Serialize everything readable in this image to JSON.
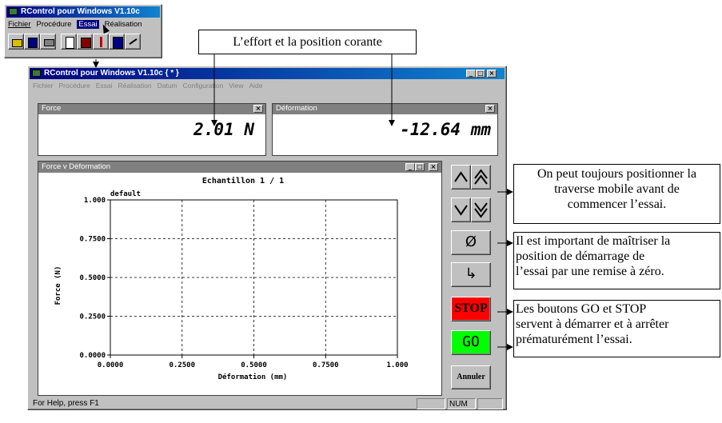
{
  "small_window": {
    "title": "RControl pour Windows V1.10c",
    "menu": [
      "Fichier",
      "Procédure",
      "Essai",
      "Réalisation"
    ],
    "highlighted_menu": "Essai",
    "toolbar_icons": [
      "open-icon",
      "save-icon",
      "print-icon",
      "report-icon",
      "zero-icon",
      "tool-icon",
      "clipboard-icon",
      "graph-icon"
    ]
  },
  "main_window": {
    "title": "RControl pour Windows V1.10c { * }",
    "menu": [
      "Fichier",
      "Procédure",
      "Essai",
      "Réalisation",
      "Datum",
      "Configuration",
      "View",
      "Aide"
    ],
    "status": {
      "help": "For Help, press F1",
      "num": "NUM"
    }
  },
  "force_panel": {
    "title": "Force",
    "value": "2.01 N"
  },
  "deformation_panel": {
    "title": "Déformation",
    "value": "-12.64 mm"
  },
  "graph_window": {
    "title": "Force v Déformation",
    "sample_label": "Echantillon 1 / 1",
    "default_label": "default"
  },
  "side_buttons": {
    "up": "^",
    "fast_up": "^^",
    "down": "v",
    "fast_down": "vv",
    "zero": "Ø",
    "return": "↳",
    "stop": "STOP",
    "go": "GO",
    "cancel": "Annuler",
    "colors": {
      "stop": "#ff0000",
      "go": "#00ff00"
    }
  },
  "callouts": {
    "top": "L’effort et la position corante",
    "move": [
      "On peut toujours positionner la",
      "traverse mobile avant de",
      "commencer l’essai."
    ],
    "zero": [
      "Il est important de maîtriser la",
      "position de démarrage de",
      "l’essai par une remise à zéro."
    ],
    "gostop": [
      "Les boutons GO et STOP",
      "servent à démarrer et à arrêter",
      "prématurément l’essai."
    ]
  },
  "chart_data": {
    "type": "line",
    "title": "Echantillon 1 / 1",
    "xlabel": "Déformation (mm)",
    "ylabel": "Force (N)",
    "xlim": [
      0,
      1
    ],
    "ylim": [
      0,
      1
    ],
    "xticks": [
      "0.0000",
      "0.2500",
      "0.5000",
      "0.7500",
      "1.000"
    ],
    "yticks": [
      "0.0000",
      "0.2500",
      "0.5000",
      "0.7500",
      "1.000"
    ],
    "grid": true,
    "series": [
      {
        "name": "default",
        "x": [],
        "y": []
      }
    ]
  }
}
